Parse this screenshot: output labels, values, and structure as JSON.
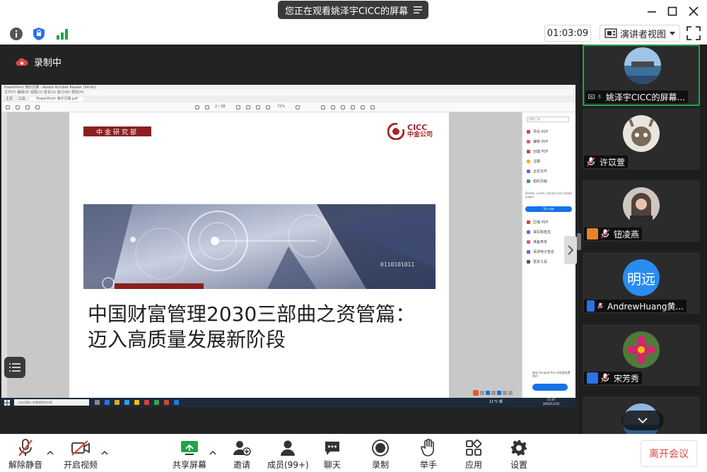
{
  "title_bar": {
    "share_banner": "您正在观看姚泽宇CICC的屏幕",
    "icons": [
      "menu-icon",
      "minimize-icon",
      "maximize-icon",
      "close-icon"
    ]
  },
  "toolbar": {
    "timer": "01:03:09",
    "view_mode": "演讲者视图",
    "icons": [
      "info-icon",
      "shield-icon",
      "signal-icon",
      "fullscreen-icon"
    ]
  },
  "stage": {
    "recording_label": "录制中",
    "shared_screen": {
      "app_title": "PowerPoint 演示文稿 - Adobe Acrobat Reader (64-bit)",
      "menu": "文件(F)  编辑(E)  视图(V)  签名(S)  窗口(W)  帮助(H)",
      "tabs": [
        "主页",
        "工具",
        "PowerPoint 演示文稿.pdf"
      ],
      "page_nav": "2 / 38",
      "zoom": "72%",
      "slide": {
        "department": "中金研究部",
        "logo_en": "CICC",
        "logo_cn": "中金公司",
        "title_line1": "中国财富管理2030三部曲之资管篇：",
        "title_line2": "迈入高质量发展新阶段"
      },
      "right_panel": {
        "search_placeholder": "搜索工具",
        "items_top": [
          "导出 PDF",
          "编辑 PDF",
          "创建 PDF",
          "注释",
          "合并文件",
          "组织页面"
        ],
        "desc": "Delete, insert, extract and rotate pages.",
        "try_now": "Try now",
        "items_bottom": [
          "压缩 PDF",
          "填写和签名",
          "准备表单",
          "请求电子签名",
          "更多工具"
        ],
        "footer": "转化 Acrobat Pro 并获取免费 PDF"
      },
      "taskbar": {
        "search": "在这里输入你要搜索的内容",
        "weather": "11°C 晴",
        "time": "11:47",
        "date": "2022/11/10"
      }
    }
  },
  "participants": [
    {
      "name": "姚泽宇CICC的屏幕...",
      "mic": "on",
      "avatar": "photo",
      "active": true,
      "badge": "screen"
    },
    {
      "name": "许苡萱",
      "mic": "muted",
      "avatar": "photo",
      "badge": "none"
    },
    {
      "name": "钮凌燕",
      "mic": "muted",
      "avatar": "photo",
      "badge": "orange"
    },
    {
      "name": "AndrewHuang黄...",
      "mic": "muted",
      "avatar": "text",
      "avatar_text": "明远",
      "badge": "blue"
    },
    {
      "name": "宋芳秀",
      "mic": "muted",
      "avatar": "photo",
      "badge": "blue"
    }
  ],
  "bottom_bar": {
    "unmute": "解除静音",
    "start_video": "开启视频",
    "share_screen": "共享屏幕",
    "invite": "邀请",
    "members": "成员(99+)",
    "chat": "聊天",
    "record": "录制",
    "raise_hand": "举手",
    "apps": "应用",
    "settings": "设置",
    "leave": "离开会议"
  },
  "colors": {
    "accent_red": "#e04848",
    "brand_red": "#8c1f1f",
    "active_green": "#23a34a",
    "host_blue": "#2a72e5"
  }
}
